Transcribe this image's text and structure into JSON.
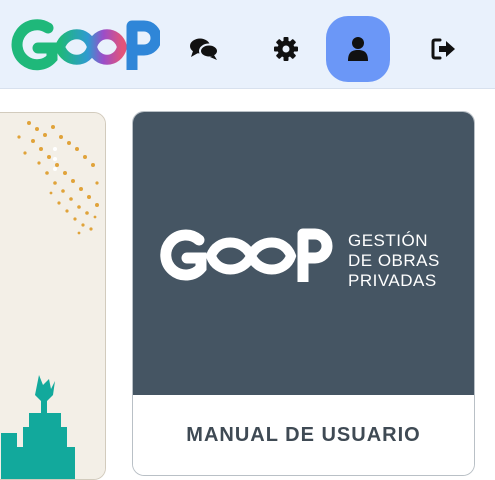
{
  "colors": {
    "topbar_bg": "#e9f1fc",
    "profile_active_bg": "#6b97f7",
    "manual_cover": "#455563",
    "manual_label": "#3f4a54",
    "logo_green": "#1fb87a",
    "logo_blue": "#2f86d8",
    "logo_purple": "#9b4dc9",
    "logo_pink": "#e2547a"
  },
  "header": {
    "logo_name": "gop-logo",
    "icons": [
      "chat-icon",
      "settings-icon",
      "profile-icon",
      "logout-icon"
    ],
    "active_item": "profile-icon"
  },
  "cards": {
    "manual": {
      "brand_line1": "GESTIÓN",
      "brand_line2": "DE OBRAS",
      "brand_line3": "PRIVADAS",
      "label": "MANUAL DE USUARIO"
    }
  }
}
